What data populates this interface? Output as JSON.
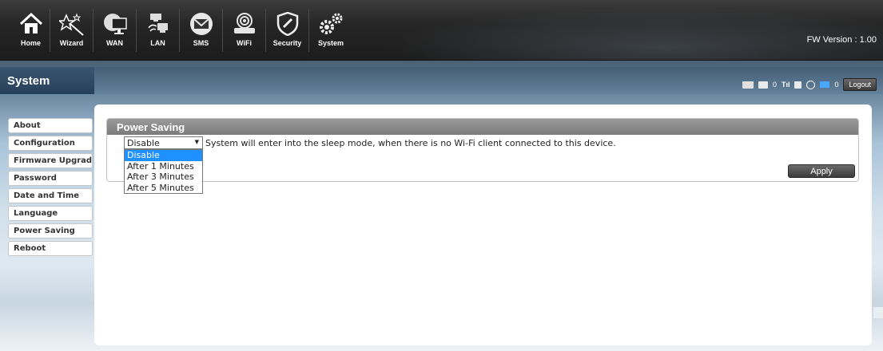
{
  "nav": {
    "items": [
      {
        "label": "Home",
        "icon": "home-icon"
      },
      {
        "label": "Wizard",
        "icon": "wizard-icon"
      },
      {
        "label": "WAN",
        "icon": "wan-icon"
      },
      {
        "label": "LAN",
        "icon": "lan-icon"
      },
      {
        "label": "SMS",
        "icon": "sms-icon"
      },
      {
        "label": "WiFi",
        "icon": "wifi-icon"
      },
      {
        "label": "Security",
        "icon": "security-icon"
      },
      {
        "label": "System",
        "icon": "system-icon"
      }
    ],
    "fw_version": "FW Version : 1.00"
  },
  "section": {
    "title": "System"
  },
  "status": {
    "sms_count": "0",
    "wifi_count": "0",
    "logout_label": "Logout"
  },
  "sidebar": {
    "items": [
      {
        "label": "About"
      },
      {
        "label": "Configuration"
      },
      {
        "label": "Firmware Upgrade"
      },
      {
        "label": "Password"
      },
      {
        "label": "Date and Time"
      },
      {
        "label": "Language"
      },
      {
        "label": "Power Saving"
      },
      {
        "label": "Reboot"
      }
    ]
  },
  "panel": {
    "title": "Power Saving",
    "select_value": "Disable",
    "description": "System will enter into the sleep mode, when there is no Wi-Fi client connected to this device.",
    "options": [
      "Disable",
      "After 1 Minutes",
      "After 3 Minutes",
      "After 5 Minutes"
    ],
    "apply_label": "Apply"
  },
  "colors": {
    "accent": "#1e90ff",
    "header_dark": "#262626",
    "panel_title": "#8a8a8a"
  }
}
